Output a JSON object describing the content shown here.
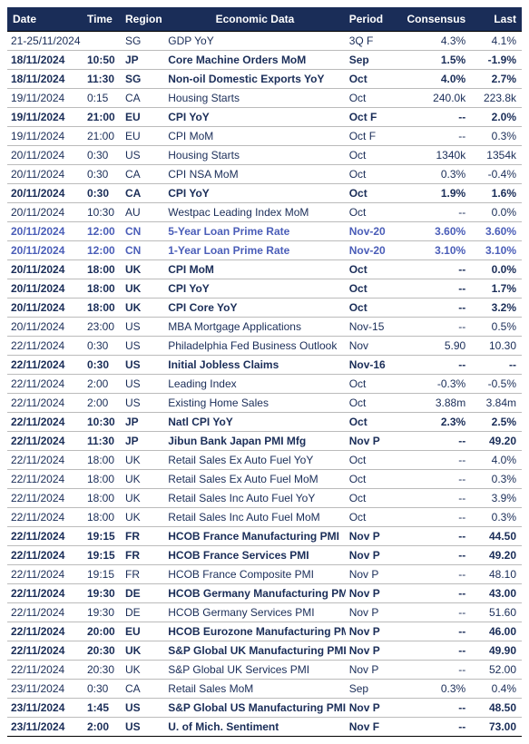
{
  "headers": {
    "date": "Date",
    "time": "Time",
    "region": "Region",
    "data": "Economic Data",
    "period": "Period",
    "consensus": "Consensus",
    "last": "Last"
  },
  "rows": [
    {
      "date": "21-25/11/2024",
      "time": "",
      "region": "SG",
      "data": "GDP YoY",
      "period": "3Q F",
      "consensus": "4.3%",
      "last": "4.1%",
      "bold": false,
      "blue": false
    },
    {
      "date": "18/11/2024",
      "time": "10:50",
      "region": "JP",
      "data": "Core Machine Orders MoM",
      "period": "Sep",
      "consensus": "1.5%",
      "last": "-1.9%",
      "bold": true,
      "blue": false
    },
    {
      "date": "18/11/2024",
      "time": "11:30",
      "region": "SG",
      "data": "Non-oil Domestic Exports YoY",
      "period": "Oct",
      "consensus": "4.0%",
      "last": "2.7%",
      "bold": true,
      "blue": false
    },
    {
      "date": "19/11/2024",
      "time": "0:15",
      "region": "CA",
      "data": "Housing Starts",
      "period": "Oct",
      "consensus": "240.0k",
      "last": "223.8k",
      "bold": false,
      "blue": false
    },
    {
      "date": "19/11/2024",
      "time": "21:00",
      "region": "EU",
      "data": "CPI YoY",
      "period": "Oct F",
      "consensus": "--",
      "last": "2.0%",
      "bold": true,
      "blue": false
    },
    {
      "date": "19/11/2024",
      "time": "21:00",
      "region": "EU",
      "data": "CPI MoM",
      "period": "Oct F",
      "consensus": "--",
      "last": "0.3%",
      "bold": false,
      "blue": false
    },
    {
      "date": "20/11/2024",
      "time": "0:30",
      "region": "US",
      "data": "Housing Starts",
      "period": "Oct",
      "consensus": "1340k",
      "last": "1354k",
      "bold": false,
      "blue": false
    },
    {
      "date": "20/11/2024",
      "time": "0:30",
      "region": "CA",
      "data": "CPI NSA MoM",
      "period": "Oct",
      "consensus": "0.3%",
      "last": "-0.4%",
      "bold": false,
      "blue": false
    },
    {
      "date": "20/11/2024",
      "time": "0:30",
      "region": "CA",
      "data": "CPI YoY",
      "period": "Oct",
      "consensus": "1.9%",
      "last": "1.6%",
      "bold": true,
      "blue": false
    },
    {
      "date": "20/11/2024",
      "time": "10:30",
      "region": "AU",
      "data": "Westpac Leading Index MoM",
      "period": "Oct",
      "consensus": "--",
      "last": "0.0%",
      "bold": false,
      "blue": false
    },
    {
      "date": "20/11/2024",
      "time": "12:00",
      "region": "CN",
      "data": "5-Year Loan Prime Rate",
      "period": "Nov-20",
      "consensus": "3.60%",
      "last": "3.60%",
      "bold": false,
      "blue": true
    },
    {
      "date": "20/11/2024",
      "time": "12:00",
      "region": "CN",
      "data": "1-Year Loan Prime Rate",
      "period": "Nov-20",
      "consensus": "3.10%",
      "last": "3.10%",
      "bold": false,
      "blue": true
    },
    {
      "date": "20/11/2024",
      "time": "18:00",
      "region": "UK",
      "data": "CPI MoM",
      "period": "Oct",
      "consensus": "--",
      "last": "0.0%",
      "bold": true,
      "blue": false
    },
    {
      "date": "20/11/2024",
      "time": "18:00",
      "region": "UK",
      "data": "CPI YoY",
      "period": "Oct",
      "consensus": "--",
      "last": "1.7%",
      "bold": true,
      "blue": false
    },
    {
      "date": "20/11/2024",
      "time": "18:00",
      "region": "UK",
      "data": "CPI Core YoY",
      "period": "Oct",
      "consensus": "--",
      "last": "3.2%",
      "bold": true,
      "blue": false
    },
    {
      "date": "20/11/2024",
      "time": "23:00",
      "region": "US",
      "data": "MBA Mortgage Applications",
      "period": "Nov-15",
      "consensus": "--",
      "last": "0.5%",
      "bold": false,
      "blue": false
    },
    {
      "date": "22/11/2024",
      "time": "0:30",
      "region": "US",
      "data": "Philadelphia Fed Business Outlook",
      "period": "Nov",
      "consensus": "5.90",
      "last": "10.30",
      "bold": false,
      "blue": false
    },
    {
      "date": "22/11/2024",
      "time": "0:30",
      "region": "US",
      "data": "Initial Jobless Claims",
      "period": "Nov-16",
      "consensus": "--",
      "last": "--",
      "bold": true,
      "blue": false
    },
    {
      "date": "22/11/2024",
      "time": "2:00",
      "region": "US",
      "data": "Leading Index",
      "period": "Oct",
      "consensus": "-0.3%",
      "last": "-0.5%",
      "bold": false,
      "blue": false
    },
    {
      "date": "22/11/2024",
      "time": "2:00",
      "region": "US",
      "data": "Existing Home Sales",
      "period": "Oct",
      "consensus": "3.88m",
      "last": "3.84m",
      "bold": false,
      "blue": false
    },
    {
      "date": "22/11/2024",
      "time": "10:30",
      "region": "JP",
      "data": "Natl CPI YoY",
      "period": "Oct",
      "consensus": "2.3%",
      "last": "2.5%",
      "bold": true,
      "blue": false
    },
    {
      "date": "22/11/2024",
      "time": "11:30",
      "region": "JP",
      "data": "Jibun Bank Japan PMI Mfg",
      "period": "Nov P",
      "consensus": "--",
      "last": "49.20",
      "bold": true,
      "blue": false
    },
    {
      "date": "22/11/2024",
      "time": "18:00",
      "region": "UK",
      "data": "Retail Sales Ex Auto Fuel YoY",
      "period": "Oct",
      "consensus": "--",
      "last": "4.0%",
      "bold": false,
      "blue": false
    },
    {
      "date": "22/11/2024",
      "time": "18:00",
      "region": "UK",
      "data": "Retail Sales Ex Auto Fuel MoM",
      "period": "Oct",
      "consensus": "--",
      "last": "0.3%",
      "bold": false,
      "blue": false
    },
    {
      "date": "22/11/2024",
      "time": "18:00",
      "region": "UK",
      "data": "Retail Sales Inc Auto Fuel YoY",
      "period": "Oct",
      "consensus": "--",
      "last": "3.9%",
      "bold": false,
      "blue": false
    },
    {
      "date": "22/11/2024",
      "time": "18:00",
      "region": "UK",
      "data": "Retail Sales Inc Auto Fuel MoM",
      "period": "Oct",
      "consensus": "--",
      "last": "0.3%",
      "bold": false,
      "blue": false
    },
    {
      "date": "22/11/2024",
      "time": "19:15",
      "region": "FR",
      "data": "HCOB France Manufacturing PMI",
      "period": "Nov P",
      "consensus": "--",
      "last": "44.50",
      "bold": true,
      "blue": false
    },
    {
      "date": "22/11/2024",
      "time": "19:15",
      "region": "FR",
      "data": "HCOB France Services PMI",
      "period": "Nov P",
      "consensus": "--",
      "last": "49.20",
      "bold": true,
      "blue": false
    },
    {
      "date": "22/11/2024",
      "time": "19:15",
      "region": "FR",
      "data": "HCOB France Composite PMI",
      "period": "Nov P",
      "consensus": "--",
      "last": "48.10",
      "bold": false,
      "blue": false
    },
    {
      "date": "22/11/2024",
      "time": "19:30",
      "region": "DE",
      "data": "HCOB Germany Manufacturing PMI",
      "period": "Nov P",
      "consensus": "--",
      "last": "43.00",
      "bold": true,
      "blue": false
    },
    {
      "date": "22/11/2024",
      "time": "19:30",
      "region": "DE",
      "data": "HCOB Germany Services PMI",
      "period": "Nov P",
      "consensus": "--",
      "last": "51.60",
      "bold": false,
      "blue": false
    },
    {
      "date": "22/11/2024",
      "time": "20:00",
      "region": "EU",
      "data": "HCOB Eurozone Manufacturing PMI",
      "period": "Nov P",
      "consensus": "--",
      "last": "46.00",
      "bold": true,
      "blue": false
    },
    {
      "date": "22/11/2024",
      "time": "20:30",
      "region": "UK",
      "data": "S&P Global UK Manufacturing PMI",
      "period": "Nov P",
      "consensus": "--",
      "last": "49.90",
      "bold": true,
      "blue": false
    },
    {
      "date": "22/11/2024",
      "time": "20:30",
      "region": "UK",
      "data": "S&P Global UK Services PMI",
      "period": "Nov P",
      "consensus": "--",
      "last": "52.00",
      "bold": false,
      "blue": false
    },
    {
      "date": "23/11/2024",
      "time": "0:30",
      "region": "CA",
      "data": "Retail Sales MoM",
      "period": "Sep",
      "consensus": "0.3%",
      "last": "0.4%",
      "bold": false,
      "blue": false
    },
    {
      "date": "23/11/2024",
      "time": "1:45",
      "region": "US",
      "data": "S&P Global US Manufacturing PMI",
      "period": "Nov P",
      "consensus": "--",
      "last": "48.50",
      "bold": true,
      "blue": false
    },
    {
      "date": "23/11/2024",
      "time": "2:00",
      "region": "US",
      "data": "U. of Mich. Sentiment",
      "period": "Nov F",
      "consensus": "--",
      "last": "73.00",
      "bold": true,
      "blue": false
    }
  ]
}
